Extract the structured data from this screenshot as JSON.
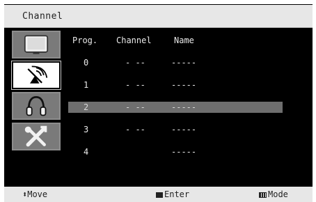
{
  "header": {
    "title": "Channel"
  },
  "sidebar": {
    "items": [
      {
        "icon": "tv-picture-icon",
        "selected": false
      },
      {
        "icon": "antenna-channel-icon",
        "selected": true
      },
      {
        "icon": "headphones-sound-icon",
        "selected": false
      },
      {
        "icon": "tools-setup-icon",
        "selected": false
      }
    ]
  },
  "table": {
    "columns": [
      "Prog.",
      "Channel",
      "Name"
    ],
    "rows": [
      {
        "prog": "0",
        "channel": "- --",
        "name": "-----",
        "highlighted": false
      },
      {
        "prog": "1",
        "channel": "- --",
        "name": "-----",
        "highlighted": false
      },
      {
        "prog": "2",
        "channel": "- --",
        "name": "-----",
        "highlighted": true
      },
      {
        "prog": "3",
        "channel": "- --",
        "name": "-----",
        "highlighted": false
      },
      {
        "prog": "4",
        "channel": "",
        "name": "-----",
        "highlighted": false
      }
    ]
  },
  "footer": {
    "move_symbol": "⬍",
    "move": "Move",
    "enter": "Enter",
    "mode": "Mode"
  },
  "colors": {
    "background": "#000000",
    "bar": "#e7e7e7",
    "highlight": "#6e6e6e"
  }
}
